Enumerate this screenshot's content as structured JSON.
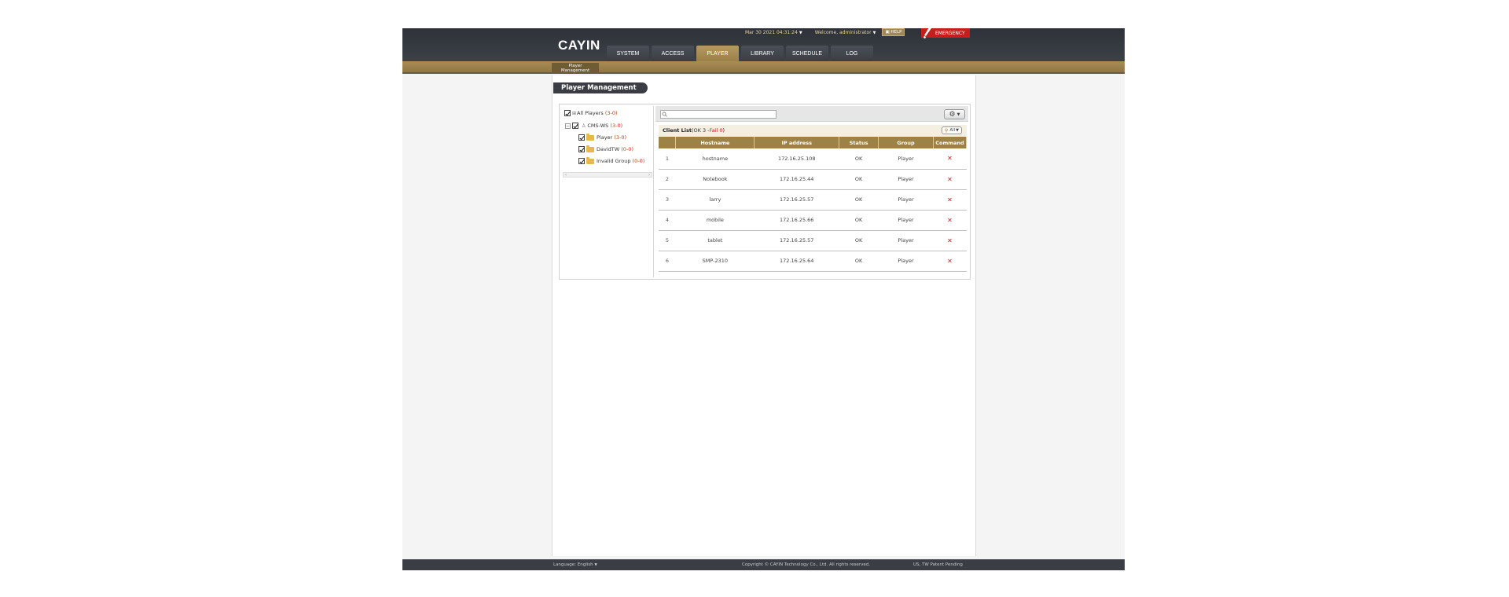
{
  "header": {
    "logo": "CAYIN",
    "datetime": "Mar 30 2021 04:31:24",
    "welcome": "Welcome, administrator",
    "help_label": "HELP",
    "emergency_label": "EMERGENCY"
  },
  "nav": {
    "tabs": [
      {
        "label": "SYSTEM"
      },
      {
        "label": "ACCESS"
      },
      {
        "label": "PLAYER"
      },
      {
        "label": "LIBRARY"
      },
      {
        "label": "SCHEDULE"
      },
      {
        "label": "LOG"
      }
    ],
    "active": "PLAYER"
  },
  "subnav": {
    "line1": "Player",
    "line2": "Management"
  },
  "page_title": "Player Management",
  "tree": {
    "all_players": {
      "label": "All Players",
      "open": "(",
      "ok": "3",
      "dash": "-",
      "fail": "0",
      "close": ")"
    },
    "server": {
      "label": "CMS-WS",
      "open": "(",
      "ok": "3",
      "dash": "-",
      "fail": "0",
      "close": ")"
    },
    "groups": [
      {
        "label": "Player",
        "open": "(",
        "ok": "3",
        "dash": "-",
        "fail": "0",
        "close": ")"
      },
      {
        "label": "DavidTW",
        "open": "(",
        "ok": "0",
        "dash": "-",
        "fail": "0",
        "close": ")"
      },
      {
        "label": "Invalid Group",
        "open": "(",
        "ok": "0",
        "dash": "-",
        "fail": "0",
        "close": ")"
      }
    ],
    "scroll_left": "‹",
    "scroll_right": "›"
  },
  "search": {
    "placeholder": ""
  },
  "client_list": {
    "title": "Client List",
    "ok_text": "(OK 3 - ",
    "fail_text": "Fail 0",
    "close_paren": ")",
    "filter_label": "All",
    "columns": [
      "",
      "Hostname",
      "IP address",
      "Status",
      "Group",
      "Command"
    ],
    "rows": [
      {
        "num": "1",
        "hostname": "hostname",
        "ip": "172.16.25.108",
        "status": "OK",
        "group": "Player"
      },
      {
        "num": "2",
        "hostname": "Notebook",
        "ip": "172.16.25.44",
        "status": "OK",
        "group": "Player"
      },
      {
        "num": "3",
        "hostname": "larry",
        "ip": "172.16.25.57",
        "status": "OK",
        "group": "Player"
      },
      {
        "num": "4",
        "hostname": "mobile",
        "ip": "172.16.25.66",
        "status": "OK",
        "group": "Player"
      },
      {
        "num": "5",
        "hostname": "tablet",
        "ip": "172.16.25.57",
        "status": "OK",
        "group": "Player"
      },
      {
        "num": "6",
        "hostname": "SMP-2310",
        "ip": "172.16.25.64",
        "status": "OK",
        "group": "Player"
      }
    ],
    "delete_glyph": "✕"
  },
  "footer": {
    "language": "Language:  English",
    "copyright": "Copyright © CAYIN Technology Co., Ltd. All rights reserved.",
    "patent": "US, TW Patent Pending"
  },
  "colors": {
    "accent": "#9c8244",
    "emergency": "#c61e1e",
    "header_bg": "#3a3e44",
    "fail_text": "#d32222"
  }
}
